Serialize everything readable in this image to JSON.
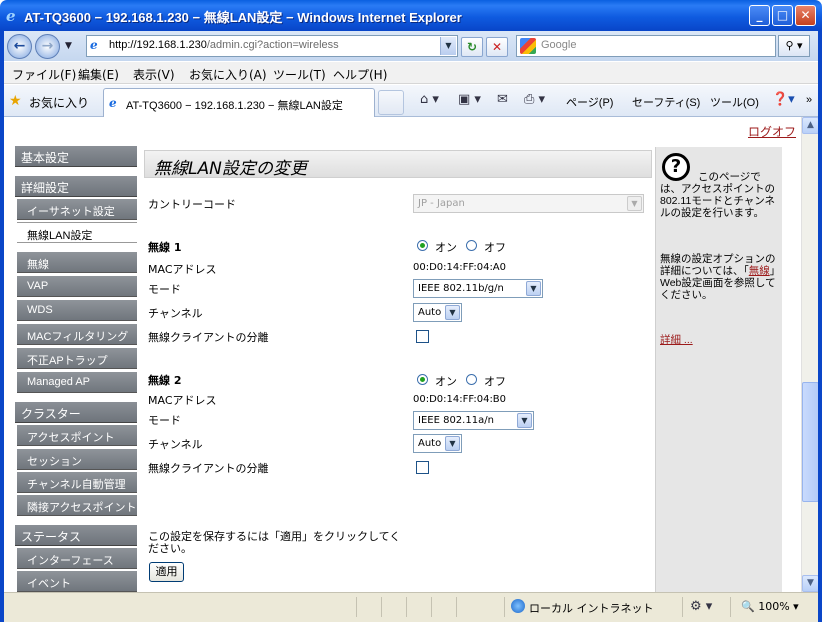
{
  "window": {
    "title": "AT-TQ3600 − 192.168.1.230 − 無線LAN設定 − Windows Internet Explorer",
    "ie_icon": "ie-logo-icon",
    "min": "_",
    "max": "□",
    "close": "✕"
  },
  "address": {
    "url_host": "http://192.168.1.230",
    "url_path": "/admin.cgi?action=wireless",
    "search_placeholder": "Google"
  },
  "menu": [
    "ファイル(F)",
    "編集(E)",
    "表示(V)",
    "お気に入り(A)",
    "ツール(T)",
    "ヘルプ(H)"
  ],
  "favorites": {
    "label": "お気に入り",
    "tab_title": "AT-TQ3600 − 192.168.1.230 − 無線LAN設定",
    "commands": {
      "page": "ページ(P)",
      "safety": "セーフティ(S)",
      "tools": "ツール(O)"
    }
  },
  "page": {
    "logout": "ログオフ",
    "nav": {
      "basic": "基本設定",
      "advanced": "詳細設定",
      "ethernet": "イーサネット設定",
      "wireless_lan": "無線LAN設定",
      "radio": "無線",
      "vap": "VAP",
      "wds": "WDS",
      "mac_filter": "MACフィルタリング",
      "rogue_ap": "不正APトラップ",
      "managed_ap": "Managed AP",
      "cluster": "クラスター",
      "access_point": "アクセスポイント",
      "session": "セッション",
      "channel_mgmt": "チャンネル自動管理",
      "neighbor_ap": "隣接アクセスポイント",
      "status": "ステータス",
      "interface": "インターフェース",
      "event": "イベント"
    },
    "title": "無線LAN設定の変更",
    "country_label": "カントリーコード",
    "country_value": "JP - Japan",
    "radio1": {
      "name": "無線 1",
      "on": "オン",
      "off": "オフ",
      "mac_label": "MACアドレス",
      "mac": "00:D0:14:FF:04:A0",
      "mode_label": "モード",
      "mode": "IEEE 802.11b/g/n",
      "channel_label": "チャンネル",
      "channel": "Auto",
      "isolation_label": "無線クライアントの分離"
    },
    "radio2": {
      "name": "無線 2",
      "on": "オン",
      "off": "オフ",
      "mac_label": "MACアドレス",
      "mac": "00:D0:14:FF:04:B0",
      "mode_label": "モード",
      "mode": "IEEE 802.11a/n",
      "channel_label": "チャンネル",
      "channel": "Auto",
      "isolation_label": "無線クライアントの分離"
    },
    "save_note": "この設定を保存するには「適用」をクリックしてください。",
    "apply": "適用",
    "help": {
      "icon": "?",
      "p1": "このページでは、アクセスポイントの802.11モードとチャンネルの設定を行います。",
      "p2_a": "無線の設定オプションの詳細については、「",
      "p2_link": "無線",
      "p2_b": "」Web設定画面を参照してください。",
      "more": "詳細 ..."
    }
  },
  "status": {
    "zone": "ローカル イントラネット",
    "zoom": "100%"
  }
}
